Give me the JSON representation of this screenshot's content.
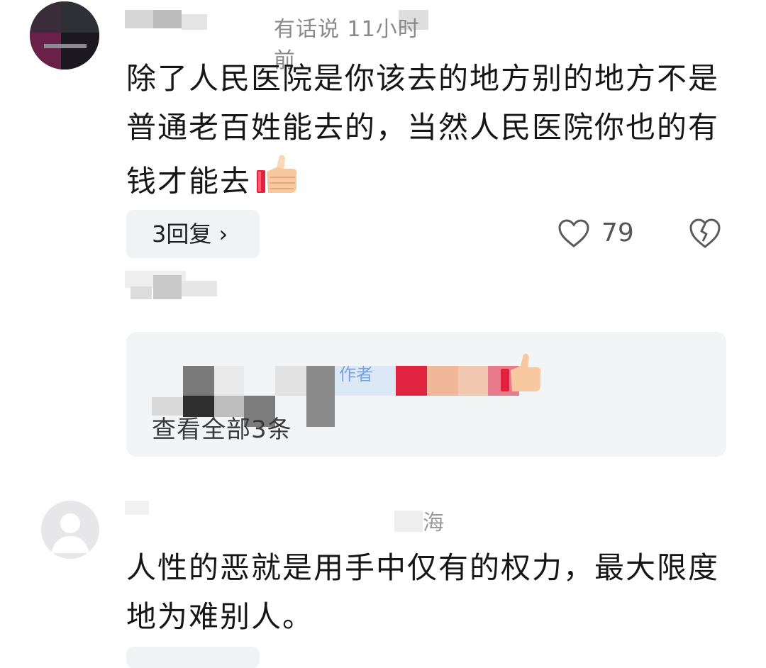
{
  "comments": [
    {
      "meta_visible": "有话说  11小时前",
      "text": "除了人民医院是你该去的地方别的地方不是普通老百姓能去的，当然人民医院你也的有钱才能去",
      "emoji": "thumbs-up",
      "reply_button": "3回复 ›",
      "likes": "79",
      "reply_preview": {
        "author_label": "作者",
        "view_all": "查看全部3条"
      }
    },
    {
      "location": "海",
      "text": "人性的恶就是用手中仅有的权力，最大限度地为难别人。"
    }
  ],
  "icons": {
    "like": "heart-outline-icon",
    "dislike": "broken-heart-icon",
    "reply_arrow": "chevron-right-icon"
  },
  "colors": {
    "text": "#161616",
    "meta": "#8a8a8a",
    "reply_bg": "#f3f4f6",
    "author_label": "#7aa3d8"
  }
}
